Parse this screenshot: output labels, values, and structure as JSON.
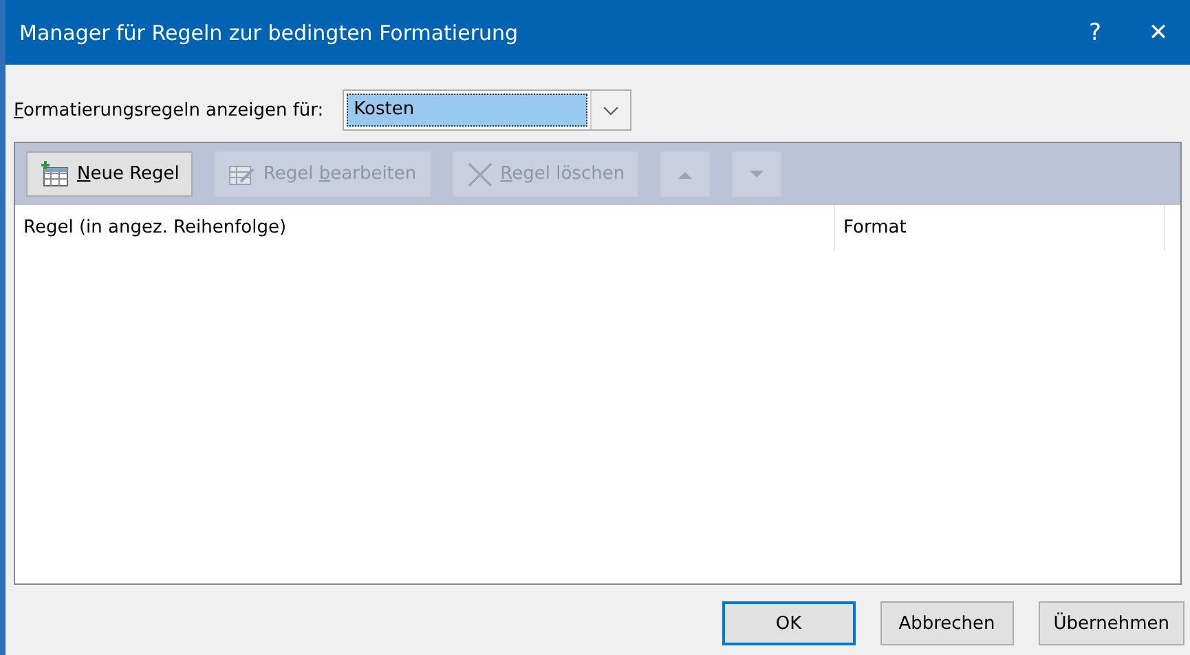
{
  "window": {
    "title": "Manager für Regeln zur bedingten Formatierung",
    "help": "?",
    "close": "✕"
  },
  "scope": {
    "label": {
      "key": "F",
      "after": "ormatierungsregeln anzeigen für:"
    },
    "value": "Kosten"
  },
  "toolbar": [
    {
      "kind": "new",
      "label": {
        "key": "N",
        "after": "eue Regel"
      },
      "disabled": false
    },
    {
      "kind": "edit",
      "label": {
        "before": "Regel ",
        "key": "b",
        "after": "earbeiten"
      },
      "disabled": true
    },
    {
      "kind": "delete",
      "label": {
        "key": "R",
        "after": "egel löschen"
      },
      "disabled": true
    },
    {
      "kind": "up",
      "disabled": true
    },
    {
      "kind": "down",
      "disabled": true
    }
  ],
  "table": {
    "columns": [
      "Regel (in angez. Reihenfolge)",
      "Format"
    ]
  },
  "buttons": [
    {
      "label": "OK",
      "default": true
    },
    {
      "label": "Abbrechen",
      "default": false
    },
    {
      "label": "Übernehmen",
      "default": false
    }
  ]
}
